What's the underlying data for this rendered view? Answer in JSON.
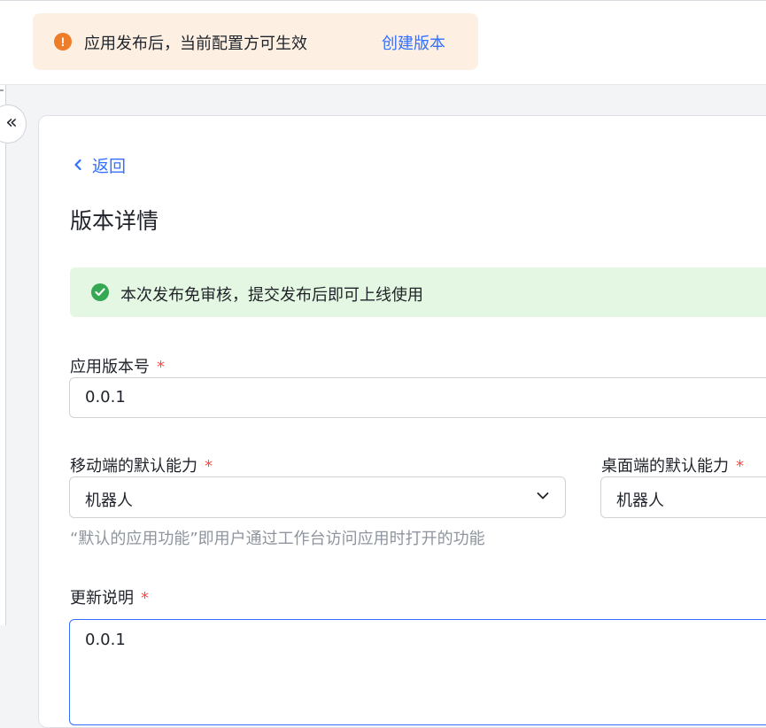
{
  "notice": {
    "text": "应用发布后，当前配置方可生效",
    "icon": "exclamation-circle-icon",
    "link": "创建版本",
    "accent": "#ee7d2a"
  },
  "sidebar": {
    "collapse_icon": "double-chevron-left-icon",
    "collapse_glyph": "«"
  },
  "detail": {
    "back_label": "返回",
    "title": "版本详情",
    "success_text": "本次发布免审核，提交发布后即可上线使用",
    "success_icon": "check-circle-icon"
  },
  "form": {
    "version": {
      "label": "应用版本号",
      "required": "*",
      "value": "0.0.1"
    },
    "mobile": {
      "label": "移动端的默认能力",
      "required": "*",
      "value": "机器人"
    },
    "desktop": {
      "label": "桌面端的默认能力",
      "required": "*",
      "value": "机器人"
    },
    "hint": "“默认的应用功能”即用户通过工作台访问应用时打开的功能",
    "notes": {
      "label": "更新说明",
      "required": "*",
      "value": "0.0.1"
    }
  },
  "colors": {
    "link": "#3370ff",
    "required": "#f54a45",
    "success_bg": "#e4f7e2",
    "notice_bg": "#fdf0e3"
  }
}
